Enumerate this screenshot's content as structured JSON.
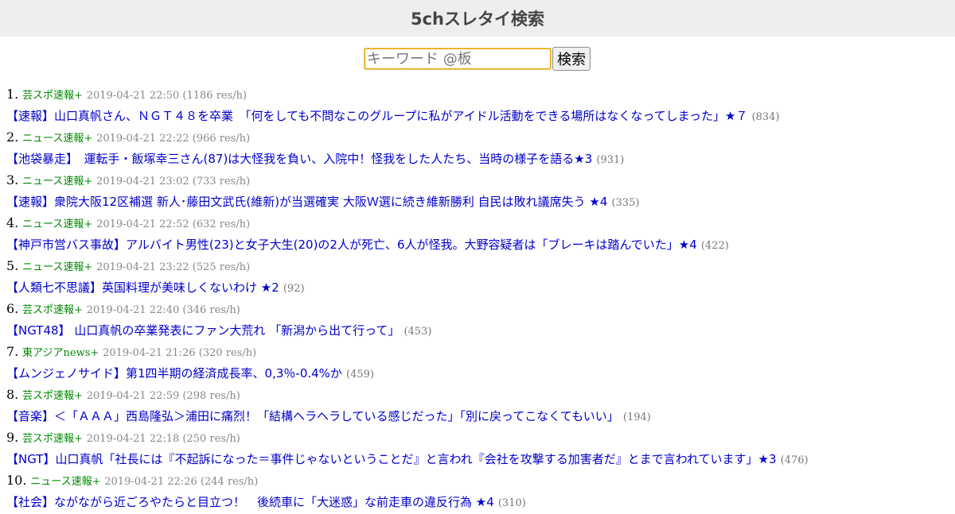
{
  "header": {
    "title": "5chスレタイ検索"
  },
  "search": {
    "placeholder": "キーワード @板",
    "value": "",
    "button_label": "検索"
  },
  "results": [
    {
      "num": "1.",
      "board": "芸スポ速報+",
      "info": "2019-04-21 22:50 (1186 res/h)",
      "title": "【速報】山口真帆さん、ＮＧＴ４８を卒業　「何をしても不問なこのグループに私がアイドル活動をできる場所はなくなってしまった」★７",
      "count": "(834)"
    },
    {
      "num": "2.",
      "board": "ニュース速報+",
      "info": "2019-04-21 22:22 (966 res/h)",
      "title": "【池袋暴走】　運転手・飯塚幸三さん(87)は大怪我を負い、入院中！怪我をした人たち、当時の様子を語る★3",
      "count": "(931)"
    },
    {
      "num": "3.",
      "board": "ニュース速報+",
      "info": "2019-04-21 23:02 (733 res/h)",
      "title": "【速報】衆院大阪12区補選 新人･藤田文武氏(維新)が当選確実 大阪Ｗ選に続き維新勝利 自民は敗れ議席失う ★4",
      "count": "(335)"
    },
    {
      "num": "4.",
      "board": "ニュース速報+",
      "info": "2019-04-21 22:52 (632 res/h)",
      "title": "【神戸市営バス事故】アルバイト男性(23)と女子大生(20)の2人が死亡、6人が怪我。大野容疑者は「ブレーキは踏んでいた」★4",
      "count": "(422)"
    },
    {
      "num": "5.",
      "board": "ニュース速報+",
      "info": "2019-04-21 23:22 (525 res/h)",
      "title": "【人類七不思議】英国料理が美味しくないわけ ★2",
      "count": "(92)"
    },
    {
      "num": "6.",
      "board": "芸スポ速報+",
      "info": "2019-04-21 22:40 (346 res/h)",
      "title": "【NGT48】 山口真帆の卒業発表にファン大荒れ 「新潟から出て行って」",
      "count": "(453)"
    },
    {
      "num": "7.",
      "board": "東アジアnews+",
      "info": "2019-04-21 21:26 (320 res/h)",
      "title": "【ムンジェノサイド】第1四半期の経済成長率、0,3％-0.4%か",
      "count": "(459)"
    },
    {
      "num": "8.",
      "board": "芸スポ速報+",
      "info": "2019-04-21 22:59 (298 res/h)",
      "title": "【音楽】＜「ＡＡＡ」西島隆弘＞浦田に痛烈！「結構ヘラヘラしている感じだった」「別に戻ってこなくてもいい」",
      "count": "(194)"
    },
    {
      "num": "9.",
      "board": "芸スポ速報+",
      "info": "2019-04-21 22:18 (250 res/h)",
      "title": "【NGT】山口真帆「社長には『不起訴になった＝事件じゃないということだ』と言われ『会社を攻撃する加害者だ』とまで言われています」★3",
      "count": "(476)"
    },
    {
      "num": "10.",
      "board": "ニュース速報+",
      "info": "2019-04-21 22:26 (244 res/h)",
      "title": "【社会】ながながら近ごろやたらと目立つ！　後続車に「大迷惑」な前走車の違反行為 ★4",
      "count": "(310)"
    }
  ]
}
